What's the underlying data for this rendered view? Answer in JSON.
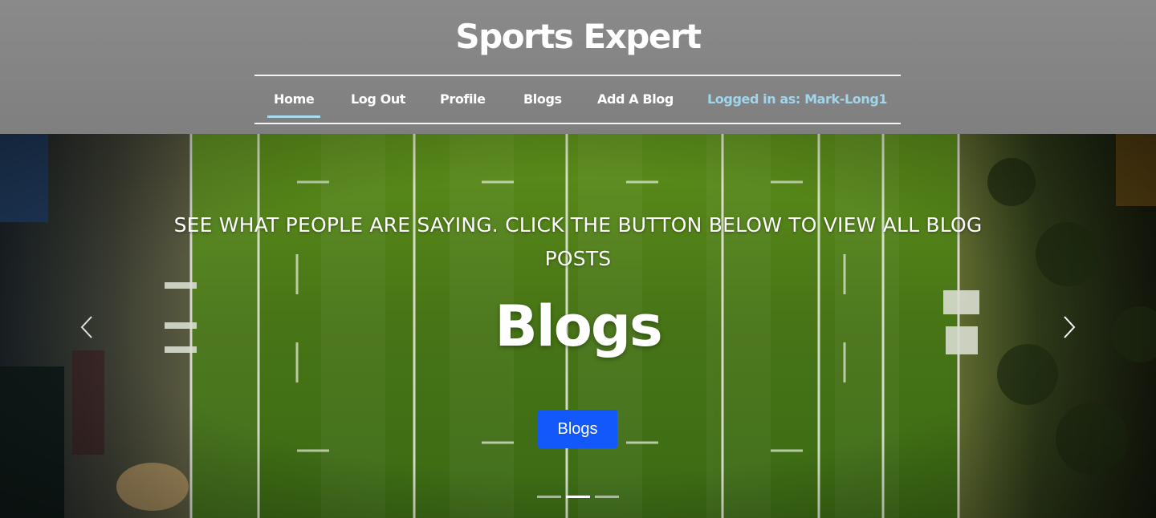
{
  "header": {
    "site_title": "Sports Expert"
  },
  "nav": {
    "items": [
      {
        "label": "Home",
        "active": true
      },
      {
        "label": "Log Out"
      },
      {
        "label": "Profile"
      },
      {
        "label": "Blogs"
      },
      {
        "label": "Add A Blog"
      }
    ],
    "logged_in_text": "Logged in as: Mark-Long1"
  },
  "carousel": {
    "caption_text": "SEE WHAT PEOPLE ARE SAYING. CLICK THE BUTTON BELOW TO VIEW ALL BLOG POSTS",
    "heading": "Blogs",
    "button_label": "Blogs",
    "prev_icon": "chevron-left-icon",
    "next_icon": "chevron-right-icon",
    "slide_count": 3,
    "active_slide": 2
  },
  "colors": {
    "header_bg": "#808080",
    "nav_active_underline": "#a6dcf0",
    "logged_in_text": "#9fd6ec",
    "button_bg": "#1358fb",
    "pitch_green": "#4f7a18"
  }
}
